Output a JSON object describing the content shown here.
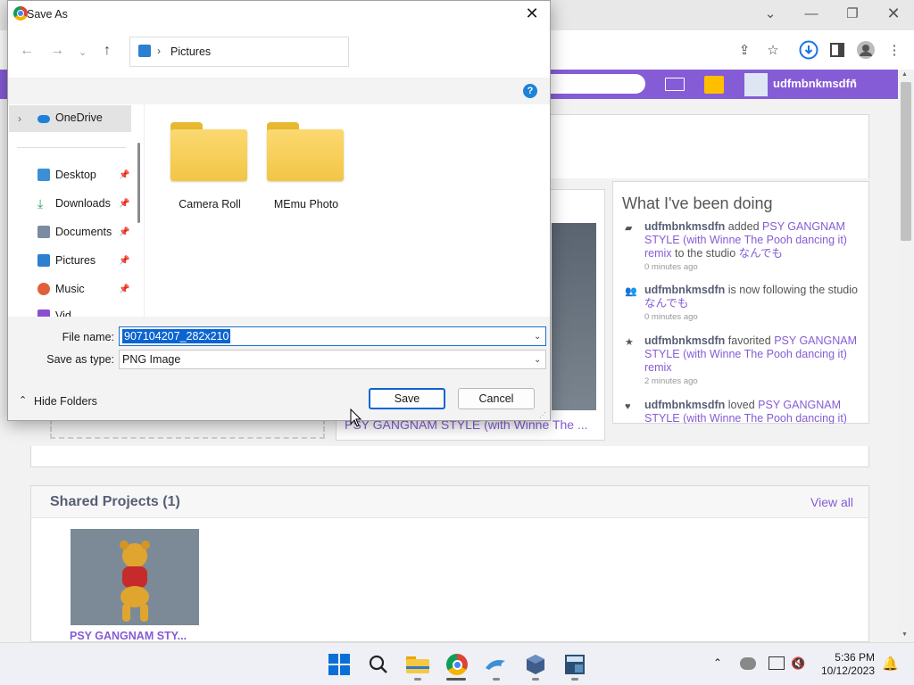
{
  "browser": {
    "user_name": "udfmbnkmsdfn",
    "colors": {
      "accent": "#855cd6",
      "link": "#855cd6"
    }
  },
  "activity": {
    "title": "What I've been doing",
    "items": [
      {
        "icon": "comment-icon",
        "user": "udfmbnkmsdfn",
        "verb": "added",
        "link": "PSY GANGNAM STYLE (with Winne The Pooh dancing it) remix",
        "tail": "to the studio",
        "studio": "なんでも",
        "time": "0 minutes ago"
      },
      {
        "icon": "follow-icon",
        "user": "udfmbnkmsdfn",
        "verb": "is now following the studio",
        "link": "なんでも",
        "tail": "",
        "studio": "",
        "time": "0 minutes ago"
      },
      {
        "icon": "star-icon",
        "user": "udfmbnkmsdfn",
        "verb": "favorited",
        "link": "PSY GANGNAM STYLE (with Winne The Pooh dancing it) remix",
        "tail": "",
        "studio": "",
        "time": "2 minutes ago"
      },
      {
        "icon": "heart-icon",
        "user": "udfmbnkmsdfn",
        "verb": "loved",
        "link": "PSY GANGNAM STYLE (with Winne The Pooh dancing it)",
        "tail": "",
        "studio": "",
        "time": ""
      }
    ]
  },
  "featured": {
    "title": "PSY GANGNAM STYLE (with Winne The ..."
  },
  "shared": {
    "title": "Shared Projects (1)",
    "view_all": "View all",
    "project_name": "PSY GANGNAM STY..."
  },
  "dialog": {
    "title": "Save As",
    "address": "Pictures",
    "nav": {
      "onedrive": "OneDrive",
      "items": [
        {
          "label": "Desktop",
          "icon": "desktop-icon",
          "color": "#3a8fd6"
        },
        {
          "label": "Downloads",
          "icon": "download-icon",
          "color": "#2a9d5c"
        },
        {
          "label": "Documents",
          "icon": "documents-icon",
          "color": "#7a8aa0"
        },
        {
          "label": "Pictures",
          "icon": "pictures-icon",
          "color": "#2d7fd0"
        },
        {
          "label": "Music",
          "icon": "music-icon",
          "color": "#e0603a"
        },
        {
          "label": "Vid",
          "icon": "videos-icon",
          "color": "#8a4fd0"
        }
      ]
    },
    "folders": [
      "Camera Roll",
      "MEmu Photo"
    ],
    "file_name_label": "File name:",
    "file_name_value": "907104207_282x210",
    "save_type_label": "Save as type:",
    "save_type_value": "PNG Image",
    "hide_folders": "Hide Folders",
    "save": "Save",
    "cancel": "Cancel",
    "help": "?"
  },
  "taskbar": {
    "time": "5:36 PM",
    "date": "10/12/2023",
    "apps": [
      "windows-start-icon",
      "search-icon",
      "file-explorer-icon",
      "chrome-icon",
      "dolphin-icon",
      "virtualbox-icon",
      "calculator-icon"
    ]
  }
}
